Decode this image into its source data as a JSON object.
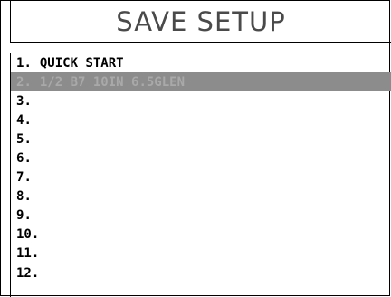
{
  "title": "SAVE SETUP",
  "colors": {
    "selected_row_bg": "#8c8c8c",
    "selected_row_text": "#a9a9a9",
    "title_text": "#4a4a4a"
  },
  "slots": [
    {
      "number": "1",
      "name": "QUICK START",
      "selected": false
    },
    {
      "number": "2",
      "name": "1/2 B7 10IN 6.5GLEN",
      "selected": true
    },
    {
      "number": "3",
      "name": "",
      "selected": false
    },
    {
      "number": "4",
      "name": "",
      "selected": false
    },
    {
      "number": "5",
      "name": "",
      "selected": false
    },
    {
      "number": "6",
      "name": "",
      "selected": false
    },
    {
      "number": "7",
      "name": "",
      "selected": false
    },
    {
      "number": "8",
      "name": "",
      "selected": false
    },
    {
      "number": "9",
      "name": "",
      "selected": false
    },
    {
      "number": "10",
      "name": "",
      "selected": false
    },
    {
      "number": "11",
      "name": "",
      "selected": false
    },
    {
      "number": "12",
      "name": "",
      "selected": false
    }
  ]
}
